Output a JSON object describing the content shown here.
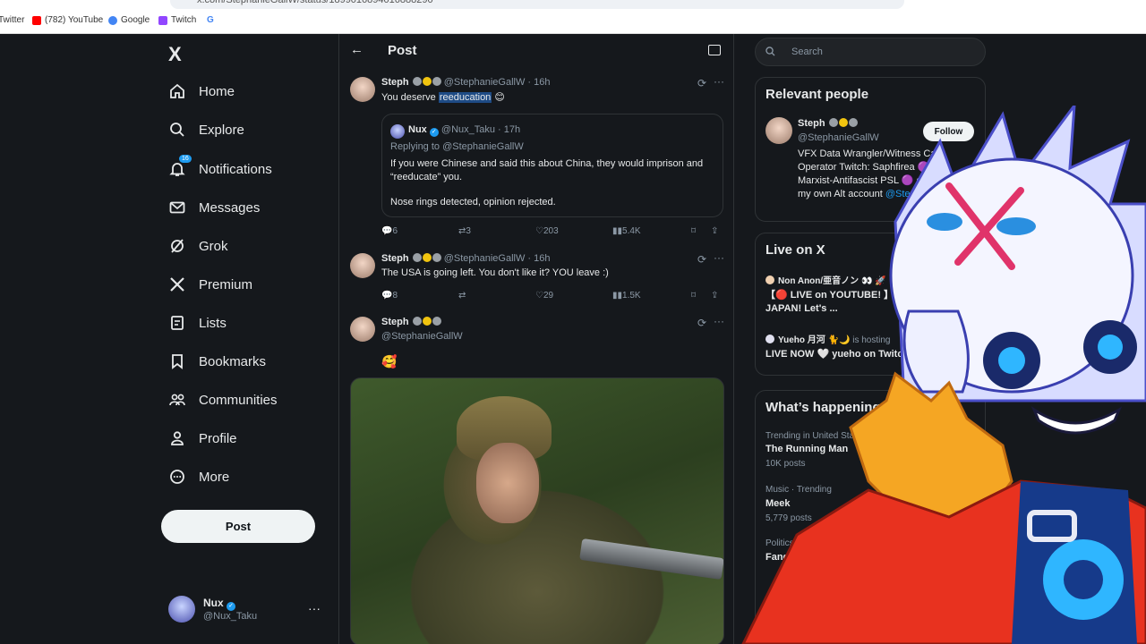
{
  "browser": {
    "url": "x.com/StephanieGallW/status/1899016894016888290",
    "bookmarks": [
      {
        "label": "Twitter",
        "color": "#1d9bf0"
      },
      {
        "label": "(782) YouTube",
        "color": "#ff0000"
      },
      {
        "label": "Google",
        "color": "#4285f4"
      },
      {
        "label": "Twitch",
        "color": "#9146ff"
      },
      {
        "label": "G",
        "color": "#4285f4"
      }
    ]
  },
  "nav": {
    "logo": "X",
    "notifications_badge": "16",
    "items": [
      {
        "label": "Home",
        "icon": "home-icon"
      },
      {
        "label": "Explore",
        "icon": "search-icon"
      },
      {
        "label": "Notifications",
        "icon": "bell-icon"
      },
      {
        "label": "Messages",
        "icon": "mail-icon"
      },
      {
        "label": "Grok",
        "icon": "grok-icon"
      },
      {
        "label": "Premium",
        "icon": "x-icon"
      },
      {
        "label": "Lists",
        "icon": "list-icon"
      },
      {
        "label": "Bookmarks",
        "icon": "bookmark-icon"
      },
      {
        "label": "Communities",
        "icon": "people-icon"
      },
      {
        "label": "Profile",
        "icon": "person-icon"
      },
      {
        "label": "More",
        "icon": "more-circle-icon"
      }
    ],
    "post_button": "Post",
    "account": {
      "name": "Nux",
      "handle": "@Nux_Taku"
    }
  },
  "center": {
    "title": "Post",
    "tweet1": {
      "name": "Steph",
      "handle": "@StephanieGallW · 16h",
      "text_before": "You deserve ",
      "text_highlight": "reeducation",
      "text_after": " 😊",
      "quote": {
        "name": "Nux",
        "handle": "@Nux_Taku · 17h",
        "replying": "Replying to @StephanieGallW",
        "text": "If you were Chinese and said this about China, they would imprison and “reeducate” you.",
        "text2": "Nose rings detected, opinion rejected."
      },
      "replies": "6",
      "reposts": "3",
      "likes": "203",
      "views": "5.4K"
    },
    "tweet2": {
      "name": "Steph",
      "handle": "@StephanieGallW · 16h",
      "text": "The USA is going left. You don't like it? YOU leave :)",
      "replies": "8",
      "likes": "29",
      "views": "1.5K"
    },
    "tweet3": {
      "name": "Steph",
      "handle": "@StephanieGallW",
      "text": "🥰"
    }
  },
  "right": {
    "search_placeholder": "Search",
    "relevant": {
      "title": "Relevant people",
      "name": "Steph",
      "handle": "@StephanieGallW",
      "follow": "Follow",
      "bio": "VFX Data Wrangler/Witness Cam Operator Twitch: Saphfirea 🟣 Bi- Marxist-Antifascist PSL 🟣 opinions are my own Alt account",
      "bio_link": "@StephanieGallW2"
    },
    "live": {
      "title": "Live on X",
      "items": [
        {
          "host": "Non Anon/亜音ノン 👀 🚀 【I-",
          "host_suffix": "",
          "text": "【🔴 LIVE on YOUTUBE! 】I'M BACK FROM JAPAN! Let's ..."
        },
        {
          "host": "Yueho 月河 🐈🌙",
          "host_suffix": "is hosting",
          "text": "LIVE NOW 🤍 yueho on Twitch"
        }
      ]
    },
    "trends": {
      "title": "What’s happening",
      "items": [
        {
          "meta": "Trending in United States",
          "name": "The Running Man",
          "count": "10K posts"
        },
        {
          "meta": "Music · Trending",
          "name": "Meek",
          "count": "5,779 posts"
        },
        {
          "meta": "Politics ·",
          "name": "Fang",
          "count": ""
        }
      ]
    }
  }
}
